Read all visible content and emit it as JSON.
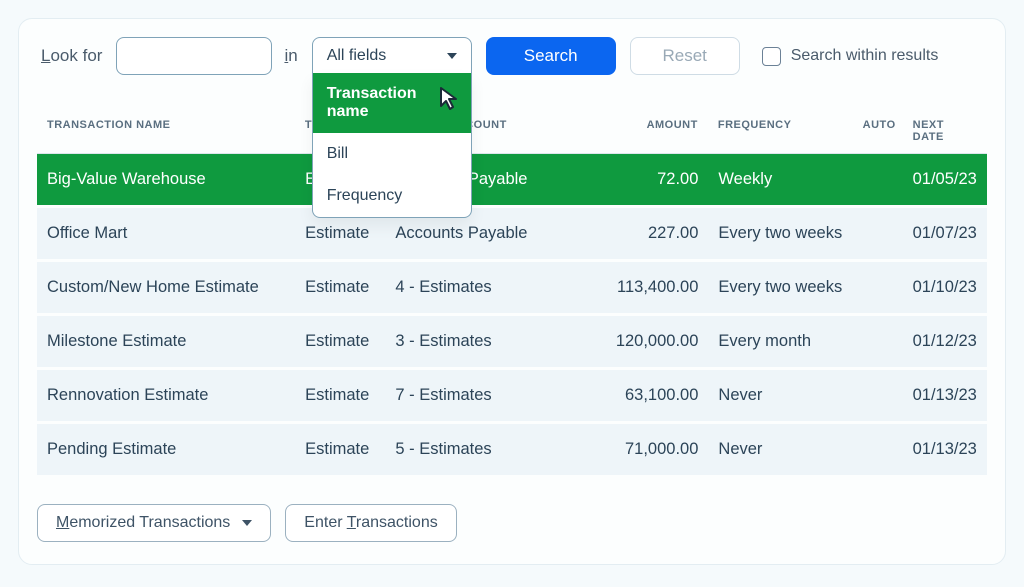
{
  "search": {
    "look_for_label_pre": "L",
    "look_for_label_rest": "ook for",
    "in_label_pre": "i",
    "in_label_rest": "n",
    "field_select_value": "All fields",
    "dropdown_options": [
      {
        "label": "Transaction name",
        "active": true
      },
      {
        "label": "Bill",
        "active": false
      },
      {
        "label": "Frequency",
        "active": false
      }
    ],
    "search_button": "Search",
    "reset_button": "Reset",
    "within_label": "Search within results"
  },
  "columns": {
    "name": "TRANSACTION NAME",
    "type": "TYPE",
    "src": "SOURCE ACCOUNT",
    "amt": "AMOUNT",
    "freq": "FREQUENCY",
    "auto": "AUTO",
    "next": "NEXT DATE"
  },
  "rows": [
    {
      "selected": true,
      "name": "Big-Value Warehouse",
      "type": "Estimate",
      "src": "Accounts Payable",
      "amt": "72.00",
      "freq": "Weekly",
      "auto": "",
      "next": "01/05/23"
    },
    {
      "selected": false,
      "name": "Office Mart",
      "type": "Estimate",
      "src": "Accounts Payable",
      "amt": "227.00",
      "freq": "Every two weeks",
      "auto": "",
      "next": "01/07/23"
    },
    {
      "selected": false,
      "name": "Custom/New Home Estimate",
      "type": "Estimate",
      "src": "4 - Estimates",
      "amt": "113,400.00",
      "freq": "Every two weeks",
      "auto": "",
      "next": "01/10/23"
    },
    {
      "selected": false,
      "name": "Milestone Estimate",
      "type": "Estimate",
      "src": "3 - Estimates",
      "amt": "120,000.00",
      "freq": "Every month",
      "auto": "",
      "next": "01/12/23"
    },
    {
      "selected": false,
      "name": "Rennovation Estimate",
      "type": "Estimate",
      "src": "7 - Estimates",
      "amt": "63,100.00",
      "freq": "Never",
      "auto": "",
      "next": "01/13/23"
    },
    {
      "selected": false,
      "name": "Pending Estimate",
      "type": "Estimate",
      "src": "5 - Estimates",
      "amt": "71,000.00",
      "freq": "Never",
      "auto": "",
      "next": "01/13/23"
    }
  ],
  "footer": {
    "memorized_pre": "M",
    "memorized_rest": "emorized Transactions",
    "enter_pre_text": "Enter ",
    "enter_ul": "T",
    "enter_rest": "ransactions"
  }
}
